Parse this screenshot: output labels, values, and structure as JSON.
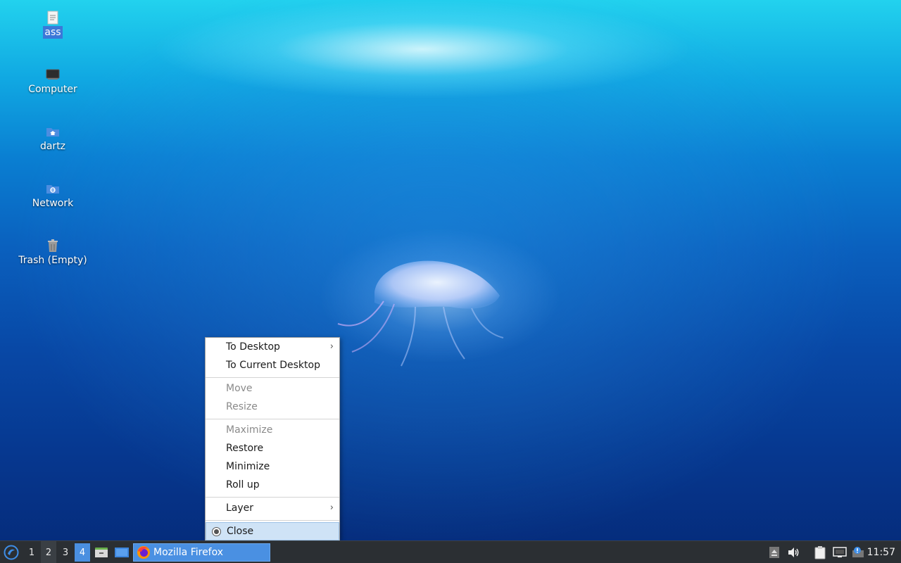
{
  "desktop": {
    "icons": [
      {
        "label": "ass",
        "icon": "text-file-icon",
        "selected": true
      },
      {
        "label": "Computer",
        "icon": "computer-icon"
      },
      {
        "label": "dartz",
        "icon": "home-folder-icon"
      },
      {
        "label": "Network",
        "icon": "network-folder-icon"
      },
      {
        "label": "Trash (Empty)",
        "icon": "trash-icon"
      }
    ]
  },
  "context_menu": {
    "items": [
      {
        "label": "To Desktop",
        "enabled": true,
        "submenu": true
      },
      {
        "label": "To Current Desktop",
        "enabled": true
      },
      {
        "label": "Move",
        "enabled": false
      },
      {
        "label": "Resize",
        "enabled": false
      },
      {
        "label": "Maximize",
        "enabled": false
      },
      {
        "label": "Restore",
        "enabled": true
      },
      {
        "label": "Minimize",
        "enabled": true
      },
      {
        "label": "Roll up",
        "enabled": true
      },
      {
        "label": "Layer",
        "enabled": true,
        "submenu": true
      },
      {
        "label": "Close",
        "enabled": true,
        "highlighted": true
      }
    ],
    "arrow_glyph": "›"
  },
  "taskbar": {
    "workspaces": [
      "1",
      "2",
      "3",
      "4"
    ],
    "current_workspace": "2",
    "active_workspace": "4",
    "task": {
      "label": "Mozilla Firefox",
      "icon": "firefox-icon"
    },
    "clock": "11:57",
    "tray_icons": [
      "eject-icon",
      "volume-icon",
      "clipboard-icon",
      "network-icon",
      "notification-icon"
    ]
  },
  "colors": {
    "menu_highlight": "#cfe3f6",
    "taskbar_bg": "#2b2f33",
    "task_active": "#4a90e2",
    "icon_selection": "#3b78d8"
  }
}
